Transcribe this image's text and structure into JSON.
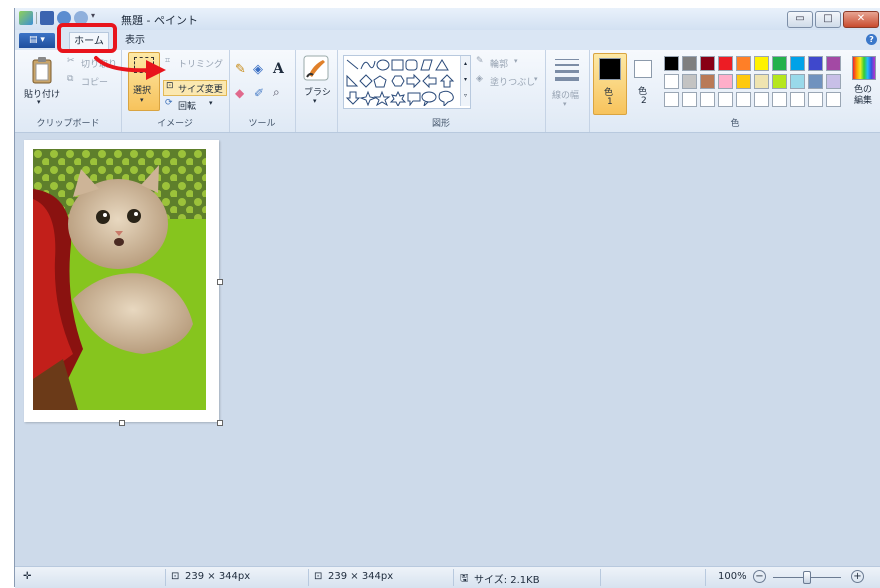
{
  "window": {
    "title": "無題 - ペイント"
  },
  "tabs": {
    "app_menu_label": "▤ ▾",
    "home": "ホーム",
    "view": "表示",
    "help": "?"
  },
  "window_buttons": {
    "minimize": "▭",
    "maximize": "□",
    "close": "✕"
  },
  "ribbon": {
    "clipboard": {
      "paste": "貼り付け",
      "cut": "切り取り",
      "copy": "コピー",
      "label": "クリップボード"
    },
    "image": {
      "select": "選択",
      "crop": "トリミング",
      "resize": "サイズ変更",
      "rotate": "回転",
      "label": "イメージ"
    },
    "tools": {
      "text_glyph": "A",
      "label": "ツール"
    },
    "brush": {
      "label": "ブラシ"
    },
    "shapes": {
      "outline": "輪郭",
      "fill": "塗りつぶし",
      "label": "図形"
    },
    "size": {
      "label": "線の幅"
    },
    "colors": {
      "color1": "色",
      "color1_num": "1",
      "color2": "色",
      "color2_num": "2",
      "edit": "色の編集",
      "label": "色",
      "palette_row1": [
        "#000000",
        "#7f7f7f",
        "#880015",
        "#ed1c24",
        "#ff7f27",
        "#fff200",
        "#22b14c",
        "#00a2e8",
        "#3f48cc",
        "#a349a4"
      ],
      "palette_row2": [
        "#ffffff",
        "#c3c3c3",
        "#b97a57",
        "#ffaec9",
        "#ffc90e",
        "#efe4b0",
        "#b5e61d",
        "#99d9ea",
        "#7092be",
        "#c8bfe7"
      ],
      "color1_value": "#000000",
      "color2_value": "#ffffff"
    }
  },
  "status": {
    "cursor_icon": "✛",
    "selection_size": "239 × 344px",
    "image_size": "239 × 344px",
    "file_size": "サイズ: 2.1KB",
    "zoom": "100%",
    "zoom_out": "−",
    "zoom_in": "+"
  }
}
